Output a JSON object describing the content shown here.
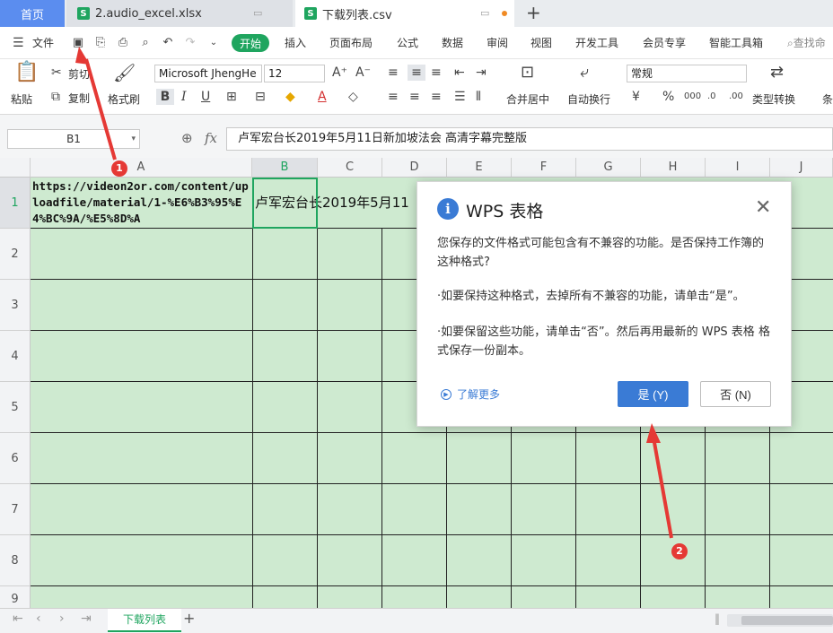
{
  "tabs": {
    "home": "首页",
    "file1": "2.audio_excel.xlsx",
    "file2": "下载列表.csv",
    "add": "+"
  },
  "menu": {
    "file": "文件",
    "start": "开始",
    "items": [
      "插入",
      "页面布局",
      "公式",
      "数据",
      "审阅",
      "视图",
      "开发工具",
      "会员专享",
      "智能工具箱"
    ],
    "search": "查找命"
  },
  "ribbon": {
    "paste": "粘贴",
    "cut": "剪切",
    "copy": "复制",
    "format_painter": "格式刷",
    "font_name": "Microsoft JhengHe",
    "font_size": "12",
    "merge_center": "合并居中",
    "wrap_text": "自动换行",
    "number_format": "常规",
    "type_convert": "类型转换",
    "cond": "条"
  },
  "formula": {
    "name_box": "B1",
    "fx": "fx",
    "content": "卢军宏台长2019年5月11日新加坡法会 高清字幕完整版"
  },
  "grid": {
    "columns": [
      "A",
      "B",
      "C",
      "D",
      "E",
      "F",
      "G",
      "H",
      "I",
      "J"
    ],
    "rows": [
      "1",
      "2",
      "3",
      "4",
      "5",
      "6",
      "7",
      "8",
      "9"
    ],
    "A1": "https://videon2or.com/content/uploadfile/material/1-%E6%B3%95%E4%BC%9A/%E5%8D%A",
    "B1": "卢军宏台长2019年5月11"
  },
  "sheetbar": {
    "sheet_name": "下载列表"
  },
  "dialog": {
    "title": "WPS 表格",
    "message1": "您保存的文件格式可能包含有不兼容的功能。是否保持工作簿的这种格式?",
    "message2": "·如要保持这种格式，去掉所有不兼容的功能，请单击“是”。",
    "message3": "·如要保留这些功能，请单击“否”。然后再用最新的 WPS 表格 格式保存一份副本。",
    "learn_more": "了解更多",
    "yes": "是 (Y)",
    "no": "否 (N)"
  },
  "annotations": {
    "badge1": "1",
    "badge2": "2"
  },
  "colors": {
    "green": "#1fa55f",
    "blue": "#3a7bd5",
    "cell_fill": "#ceead0",
    "annotation_red": "#e53935"
  }
}
